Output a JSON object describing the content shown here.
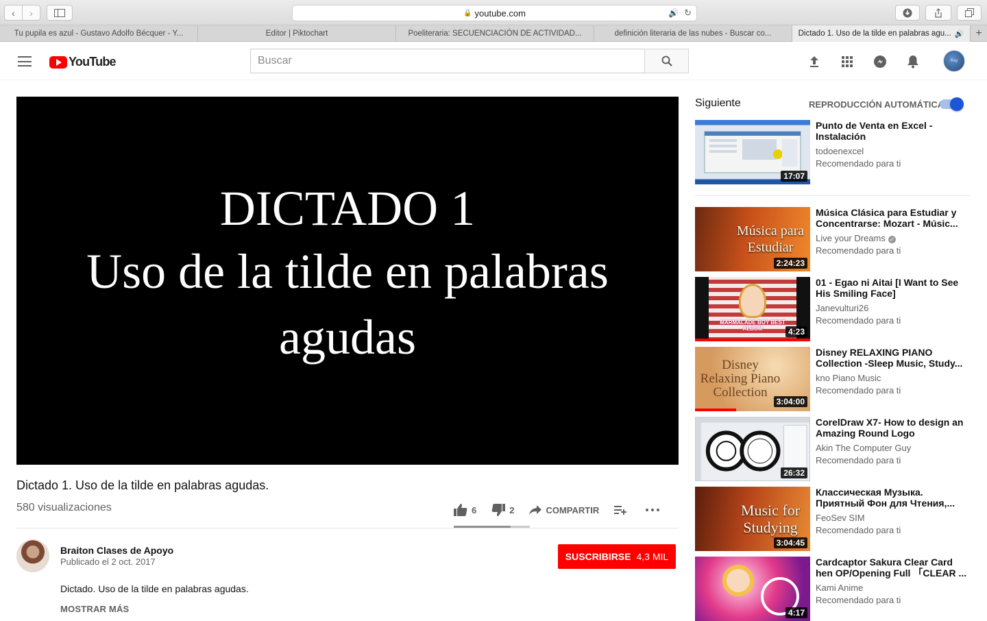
{
  "browser": {
    "url": "youtube.com",
    "tabs": [
      {
        "label": "Tu pupila es azul - Gustavo Adolfo Bécquer - Y..."
      },
      {
        "label": "Editor | Piktochart"
      },
      {
        "label": "Poeliteraria: SECUENCIACIÓN DE ACTIVIDAD..."
      },
      {
        "label": "definición literaria de las nubes - Buscar co..."
      },
      {
        "label": "Dictado 1. Uso de la tilde en palabras agu..."
      }
    ]
  },
  "header": {
    "logo_text": "YouTube",
    "search_placeholder": "Buscar",
    "avatar_text": "Ray"
  },
  "video": {
    "frame_line1": "DICTADO 1",
    "frame_line2": "Uso de la tilde en palabras agudas",
    "title": "Dictado 1. Uso de la tilde en palabras agudas.",
    "views": "580 visualizaciones",
    "likes": "6",
    "dislikes": "2",
    "share_label": "COMPARTIR",
    "like_ratio": 0.75
  },
  "channel": {
    "name": "Braiton Clases de Apoyo",
    "published": "Publicado el 2 oct. 2017",
    "subscribe_label": "SUSCRIBIRSE",
    "subscriber_count": "4,3 MIL",
    "description": "Dictado. Uso de la tilde en palabras agudas.",
    "show_more": "MOSTRAR MÁS"
  },
  "sidebar": {
    "up_next_label": "Siguiente",
    "autoplay_label": "REPRODUCCIÓN AUTOMÁTICA",
    "autoplay_on": true,
    "items": [
      {
        "title": "Punto de Venta en Excel - Instalación",
        "channel": "todoenexcel",
        "rec": "Recomendado para ti",
        "duration": "17:07",
        "thumb_text": ""
      },
      {
        "title": "Música Clásica para Estudiar y Concentrarse: Mozart - Músic...",
        "channel": "Live your Dreams",
        "rec": "Recomendado para ti",
        "duration": "2:24:23",
        "thumb_text": "Música para Estudiar"
      },
      {
        "title": "01 - Egao ni Aitai [I Want to See His Smiling Face]",
        "channel": "Janevulturi26",
        "rec": "Recomendado para ti",
        "duration": "4:23",
        "thumb_text": "MARMALADE BOY BEST ALBUM"
      },
      {
        "title": "Disney RELAXING PIANO Collection -Sleep Music, Study...",
        "channel": "kno Piano Music",
        "rec": "Recomendado para ti",
        "duration": "3:04:00",
        "thumb_text": "Disney Relaxing Piano Collection"
      },
      {
        "title": "CorelDraw X7- How to design an Amazing Round Logo",
        "channel": "Akin The Computer Guy",
        "rec": "Recomendado para ti",
        "duration": "26:32",
        "thumb_text": ""
      },
      {
        "title": "Классическая Музыка. Приятный Фон для Чтения,...",
        "channel": "FeoSev SIM",
        "rec": "Recomendado para ti",
        "duration": "3:04:45",
        "thumb_text": "Music for Studying"
      },
      {
        "title": "Cardcaptor Sakura Clear Card hen OP/Opening Full 「CLEAR ...",
        "channel": "Kami Anime",
        "rec": "Recomendado para ti",
        "duration": "4:17",
        "thumb_text": ""
      }
    ]
  }
}
